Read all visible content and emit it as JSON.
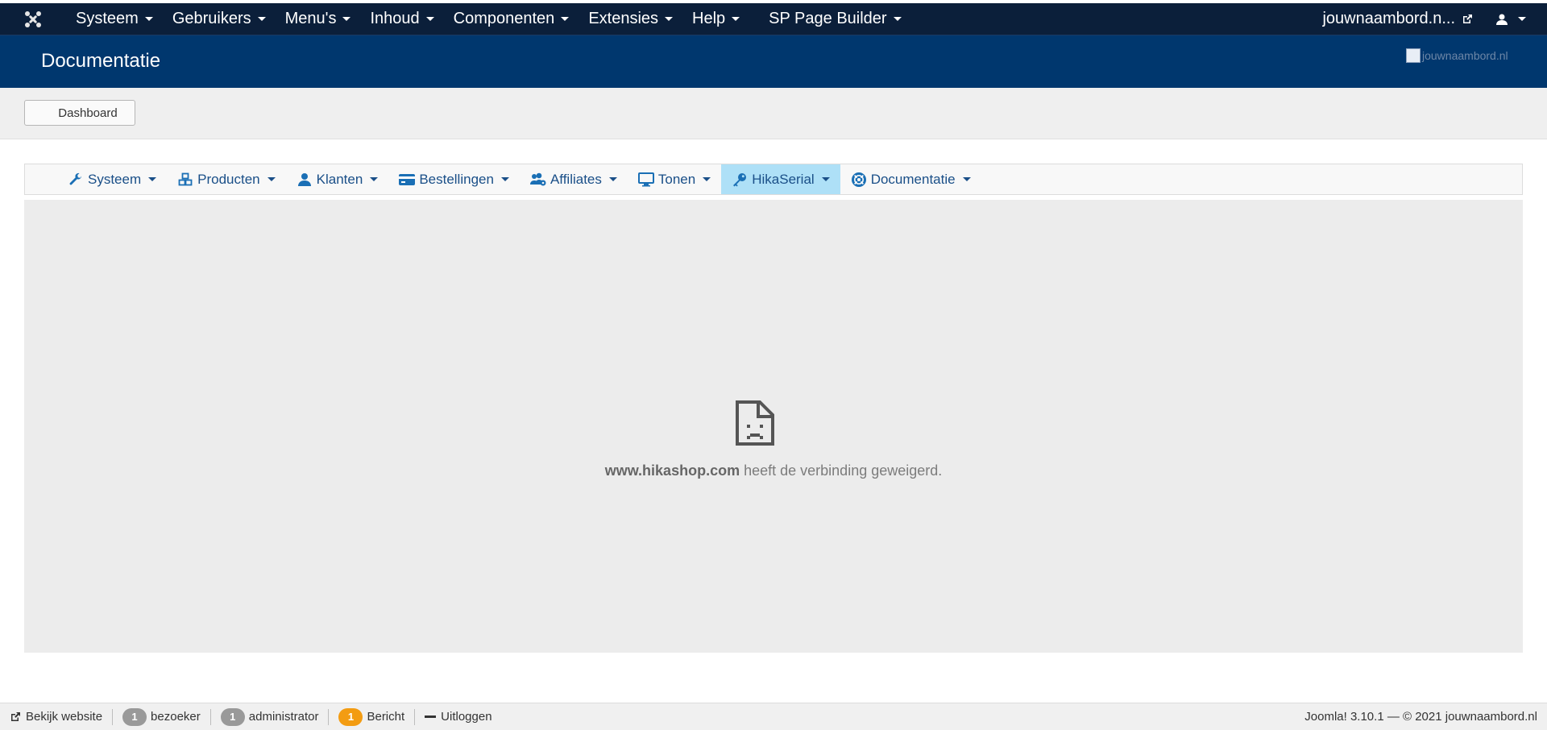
{
  "topbar": {
    "logo_icon": "joomla-logo-icon",
    "menu": [
      "Systeem",
      "Gebruikers",
      "Menu's",
      "Inhoud",
      "Componenten",
      "Extensies",
      "Help"
    ],
    "sp_page_builder": "SP Page Builder",
    "site_name": "jouwnaambord.n...",
    "user_icon": "user-icon"
  },
  "header": {
    "title": "Documentatie",
    "brand_img_alt": "jouwnaambord.nl"
  },
  "toolbar": {
    "dashboard_label": "Dashboard"
  },
  "hika_nav": {
    "items": [
      {
        "label": "Systeem",
        "icon": "wrench-icon"
      },
      {
        "label": "Producten",
        "icon": "cubes-icon"
      },
      {
        "label": "Klanten",
        "icon": "user-icon"
      },
      {
        "label": "Bestellingen",
        "icon": "credit-card-icon"
      },
      {
        "label": "Affiliates",
        "icon": "users-cog-icon"
      },
      {
        "label": "Tonen",
        "icon": "monitor-icon"
      },
      {
        "label": "HikaSerial",
        "icon": "key-icon",
        "active": true
      },
      {
        "label": "Documentatie",
        "icon": "life-ring-icon"
      }
    ],
    "active_color": "#aee0f7",
    "link_color": "#1a4f88"
  },
  "frame": {
    "error_domain": "www.hikashop.com",
    "error_text": " heeft de verbinding geweigerd."
  },
  "statusbar": {
    "view_site": "Bekijk website",
    "visitors_count": "1",
    "visitors_label": "bezoeker",
    "admins_count": "1",
    "admins_label": "administrator",
    "messages_count": "1",
    "messages_label": "Bericht",
    "logout_label": "Uitloggen",
    "copyright": "Joomla! 3.10.1  —  © 2021 jouwnaambord.nl"
  }
}
